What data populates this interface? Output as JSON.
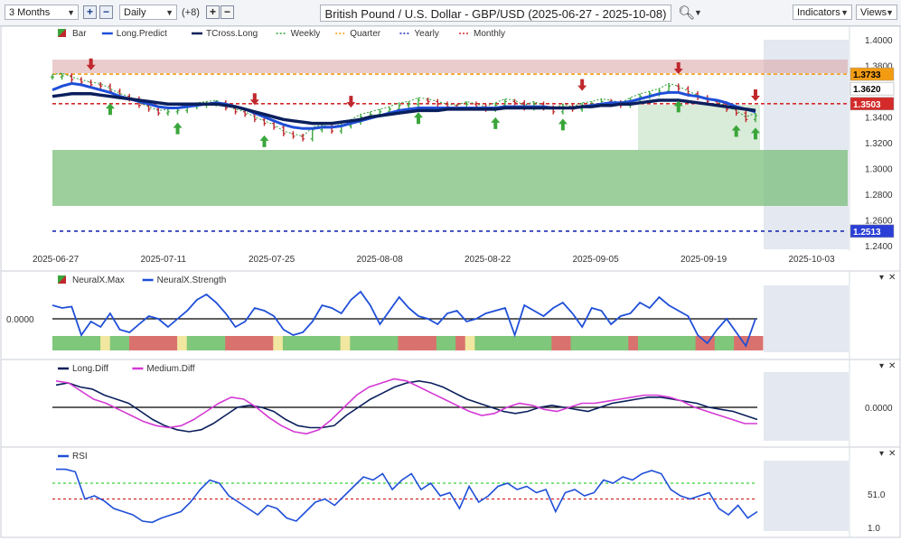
{
  "toolbar": {
    "range": "3 Months",
    "interval": "Daily",
    "offset": "(+8)",
    "title": "British Pound / U.S. Dollar - GBP/USD (2025-06-27 - 2025-10-08)",
    "indicators_label": "Indicators",
    "views_label": "Views",
    "zoom_in_icon": "plus-icon",
    "zoom_out_icon": "minus-icon",
    "search_icon": "magnifier-icon"
  },
  "legend_main": [
    "Bar",
    "Long.Predict",
    "TCross.Long",
    "Weekly",
    "Quarter",
    "Yearly",
    "Monthly"
  ],
  "legend_neural": [
    "NeuralX.Max",
    "NeuralX.Strength"
  ],
  "legend_diff": [
    "Long.Diff",
    "Medium.Diff"
  ],
  "legend_rsi": [
    "RSI"
  ],
  "colors": {
    "up": "#3aa63a",
    "down": "#c0282d",
    "long_predict": "#1f4fd8",
    "tcross_long": "#0a1f5c",
    "weekly": "#2e9d3a",
    "quarter": "#f39c12",
    "yearly": "#1a2fb5",
    "monthly": "#d42a2a",
    "rsi": "#1f4fd8",
    "medium_diff": "#d43ad4"
  },
  "chart_data": [
    {
      "type": "line",
      "title": "British Pound / U.S. Dollar - GBP/USD",
      "x_tick_labels": [
        "2025-06-27",
        "2025-07-11",
        "2025-07-25",
        "2025-08-08",
        "2025-08-22",
        "2025-09-05",
        "2025-09-19",
        "2025-10-03"
      ],
      "y_tick_labels": [
        "1.4000",
        "1.3800",
        "1.3600",
        "1.3400",
        "1.3200",
        "1.3000",
        "1.2800",
        "1.2600",
        "1.2400"
      ],
      "ylim": [
        1.24,
        1.4
      ],
      "price_labels": [
        {
          "text": "1.3733",
          "value": 1.3733,
          "color": "#f39c12"
        },
        {
          "text": "1.3620",
          "value": 1.362,
          "color": "#ffffff"
        },
        {
          "text": "1.3503",
          "value": 1.3503,
          "color": "#d42a2a"
        },
        {
          "text": "1.2513",
          "value": 1.2513,
          "color": "#2b3fd6"
        }
      ],
      "close": [
        1.371,
        1.372,
        1.369,
        1.367,
        1.365,
        1.364,
        1.36,
        1.356,
        1.354,
        1.349,
        1.346,
        1.343,
        1.344,
        1.345,
        1.348,
        1.349,
        1.35,
        1.351,
        1.347,
        1.344,
        1.342,
        1.338,
        1.335,
        1.332,
        1.327,
        1.325,
        1.323,
        1.33,
        1.332,
        1.329,
        1.333,
        1.336,
        1.34,
        1.342,
        1.344,
        1.346,
        1.349,
        1.35,
        1.353,
        1.352,
        1.35,
        1.348,
        1.347,
        1.35,
        1.348,
        1.346,
        1.349,
        1.352,
        1.351,
        1.347,
        1.35,
        1.347,
        1.344,
        1.348,
        1.346,
        1.349,
        1.35,
        1.352,
        1.351,
        1.349,
        1.353,
        1.356,
        1.358,
        1.36,
        1.364,
        1.362,
        1.358,
        1.355,
        1.352,
        1.35,
        1.346,
        1.343,
        1.338,
        1.341
      ],
      "series": [
        {
          "name": "Long.Predict",
          "values": [
            1.361,
            1.364,
            1.366,
            1.365,
            1.363,
            1.361,
            1.359,
            1.356,
            1.354,
            1.352,
            1.35,
            1.348,
            1.347,
            1.347,
            1.348,
            1.349,
            1.35,
            1.351,
            1.35,
            1.348,
            1.346,
            1.343,
            1.34,
            1.337,
            1.334,
            1.332,
            1.331,
            1.331,
            1.332,
            1.332,
            1.333,
            1.335,
            1.337,
            1.339,
            1.341,
            1.343,
            1.345,
            1.346,
            1.347,
            1.347,
            1.347,
            1.347,
            1.347,
            1.347,
            1.347,
            1.347,
            1.347,
            1.348,
            1.348,
            1.348,
            1.348,
            1.348,
            1.347,
            1.347,
            1.347,
            1.348,
            1.349,
            1.35,
            1.351,
            1.351,
            1.352,
            1.354,
            1.356,
            1.358,
            1.359,
            1.359,
            1.357,
            1.356,
            1.354,
            1.353,
            1.351,
            1.348,
            1.346,
            1.344
          ]
        },
        {
          "name": "TCross.Long",
          "values": [
            1.356,
            1.357,
            1.358,
            1.358,
            1.358,
            1.357,
            1.356,
            1.355,
            1.354,
            1.353,
            1.352,
            1.351,
            1.35,
            1.35,
            1.35,
            1.35,
            1.35,
            1.35,
            1.349,
            1.348,
            1.346,
            1.344,
            1.342,
            1.34,
            1.338,
            1.337,
            1.336,
            1.335,
            1.335,
            1.335,
            1.336,
            1.337,
            1.338,
            1.34,
            1.341,
            1.342,
            1.343,
            1.344,
            1.345,
            1.345,
            1.345,
            1.346,
            1.346,
            1.346,
            1.346,
            1.346,
            1.346,
            1.347,
            1.347,
            1.347,
            1.347,
            1.347,
            1.347,
            1.347,
            1.347,
            1.348,
            1.348,
            1.349,
            1.349,
            1.35,
            1.35,
            1.351,
            1.352,
            1.353,
            1.353,
            1.353,
            1.352,
            1.351,
            1.35,
            1.349,
            1.348,
            1.347,
            1.346,
            1.345
          ]
        }
      ],
      "levels": [
        {
          "name": "Quarter",
          "value": 1.3733
        },
        {
          "name": "Monthly",
          "value": 1.3503
        },
        {
          "name": "Yearly",
          "value": 1.2513
        }
      ]
    },
    {
      "type": "line",
      "title": "",
      "y_tick_labels": [
        "0.0000"
      ],
      "series": [
        {
          "name": "NeuralX.Strength",
          "values": [
            0.5,
            0.4,
            0.45,
            -0.6,
            -0.1,
            -0.3,
            0.2,
            -0.4,
            -0.5,
            -0.2,
            0.1,
            0.0,
            -0.3,
            0.0,
            0.3,
            0.7,
            0.9,
            0.6,
            0.2,
            -0.3,
            -0.1,
            0.4,
            0.3,
            0.1,
            -0.4,
            -0.6,
            -0.5,
            -0.1,
            0.5,
            0.4,
            0.2,
            0.7,
            1.0,
            0.5,
            -0.2,
            0.3,
            0.8,
            0.4,
            0.1,
            0.0,
            -0.2,
            0.2,
            0.3,
            -0.1,
            0.0,
            0.2,
            0.3,
            0.4,
            -0.6,
            0.5,
            0.3,
            0.1,
            0.4,
            0.6,
            0.2,
            -0.3,
            0.4,
            0.3,
            -0.2,
            0.1,
            0.2,
            0.6,
            0.4,
            0.8,
            0.5,
            0.3,
            0.1,
            -0.6,
            -0.9,
            -0.4,
            0.0,
            -0.5,
            -1.0,
            0.0
          ]
        },
        {
          "name": "NeuralX.Max",
          "values": [
            1,
            1,
            1,
            1,
            1,
            0,
            1,
            1,
            -1,
            -1,
            -1,
            -1,
            -1,
            0,
            1,
            1,
            1,
            1,
            -1,
            -1,
            -1,
            -1,
            -1,
            0,
            1,
            1,
            1,
            1,
            1,
            1,
            0,
            1,
            1,
            1,
            1,
            1,
            -1,
            -1,
            -1,
            -1,
            1,
            1,
            -1,
            0,
            1,
            1,
            1,
            1,
            1,
            1,
            1,
            1,
            -1,
            -1,
            1,
            1,
            1,
            1,
            1,
            1,
            -1,
            1,
            1,
            1,
            1,
            1,
            1,
            -1,
            -1,
            1,
            1,
            -1,
            -1,
            -1
          ]
        }
      ]
    },
    {
      "type": "line",
      "title": "",
      "y_tick_labels": [
        "0.0000"
      ],
      "series": [
        {
          "name": "Long.Diff",
          "values": [
            0.55,
            0.6,
            0.5,
            0.45,
            0.3,
            0.2,
            0.1,
            -0.1,
            -0.3,
            -0.45,
            -0.55,
            -0.6,
            -0.55,
            -0.4,
            -0.2,
            0.0,
            0.05,
            0.0,
            -0.1,
            -0.3,
            -0.45,
            -0.5,
            -0.5,
            -0.45,
            -0.2,
            0.0,
            0.2,
            0.35,
            0.5,
            0.6,
            0.65,
            0.6,
            0.5,
            0.35,
            0.2,
            0.1,
            0.0,
            -0.1,
            -0.15,
            -0.1,
            0.0,
            0.05,
            0.0,
            -0.05,
            -0.1,
            0.0,
            0.1,
            0.15,
            0.2,
            0.25,
            0.25,
            0.2,
            0.15,
            0.1,
            0.0,
            -0.05,
            -0.1,
            -0.2,
            -0.3
          ]
        },
        {
          "name": "Medium.Diff",
          "values": [
            0.65,
            0.6,
            0.4,
            0.2,
            0.1,
            -0.05,
            -0.2,
            -0.35,
            -0.45,
            -0.5,
            -0.45,
            -0.3,
            -0.1,
            0.1,
            0.25,
            0.2,
            0.0,
            -0.25,
            -0.45,
            -0.6,
            -0.65,
            -0.55,
            -0.3,
            0.0,
            0.3,
            0.5,
            0.6,
            0.7,
            0.65,
            0.5,
            0.35,
            0.2,
            0.05,
            -0.1,
            -0.2,
            -0.15,
            0.0,
            0.1,
            0.05,
            -0.05,
            -0.1,
            0.0,
            0.1,
            0.1,
            0.15,
            0.2,
            0.25,
            0.3,
            0.3,
            0.25,
            0.15,
            0.0,
            -0.1,
            -0.2,
            -0.3,
            -0.4,
            -0.4
          ]
        }
      ]
    },
    {
      "type": "line",
      "title": "",
      "y_tick_labels": [
        "51.0",
        "1.0"
      ],
      "ylim": [
        0,
        100
      ],
      "series": [
        {
          "name": "RSI",
          "values": [
            92,
            92,
            88,
            45,
            50,
            42,
            30,
            25,
            20,
            10,
            8,
            15,
            20,
            25,
            40,
            60,
            75,
            70,
            50,
            40,
            30,
            20,
            35,
            30,
            15,
            10,
            25,
            40,
            45,
            35,
            50,
            65,
            80,
            75,
            85,
            60,
            75,
            85,
            60,
            70,
            50,
            55,
            30,
            65,
            40,
            50,
            65,
            70,
            60,
            65,
            55,
            60,
            25,
            55,
            60,
            50,
            55,
            75,
            70,
            80,
            75,
            85,
            90,
            85,
            60,
            50,
            45,
            50,
            55,
            30,
            20,
            35,
            15,
            25
          ]
        }
      ],
      "levels": [
        {
          "name": "upper",
          "value": 70
        },
        {
          "name": "lower",
          "value": 45
        }
      ]
    }
  ]
}
